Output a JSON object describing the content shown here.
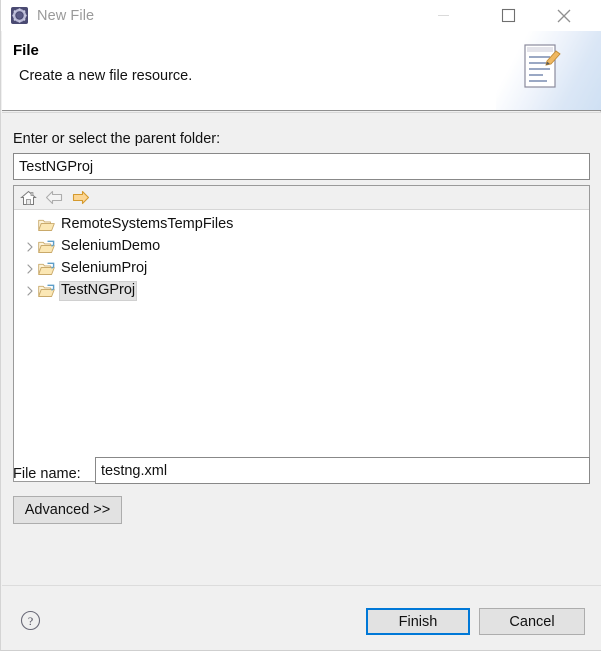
{
  "window": {
    "title": "New File",
    "icon": "eclipse-wizard-icon",
    "controls": [
      {
        "name": "minimize-button",
        "icon": "minimize-icon",
        "label": "Minimize"
      },
      {
        "name": "maximize-button",
        "icon": "maximize-icon",
        "label": "Maximize"
      },
      {
        "name": "close-button",
        "icon": "close-icon",
        "label": "Close"
      }
    ]
  },
  "header": {
    "title": "File",
    "description": "Create a new file resource.",
    "banner_icon": "new-file-document-pencil-icon"
  },
  "form": {
    "parent_folder_label": "Enter or select the parent folder:",
    "parent_folder_value": "TestNGProj",
    "parent_folder_placeholder": "",
    "file_name_label": "File name:",
    "file_name_value": "testng.xml",
    "file_name_placeholder": "",
    "advanced_label": "Advanced >>"
  },
  "tree": {
    "toolbar": [
      {
        "name": "home-button",
        "icon": "home-icon",
        "label": "Home"
      },
      {
        "name": "back-button",
        "icon": "back-arrow-icon",
        "label": "Back"
      },
      {
        "name": "forward-button",
        "icon": "forward-arrow-icon",
        "label": "Forward"
      }
    ],
    "items": [
      {
        "label": "RemoteSystemsTempFiles",
        "expandable": false,
        "selected": false,
        "icon": "folder-icon"
      },
      {
        "label": "SeleniumDemo",
        "expandable": true,
        "selected": false,
        "icon": "project-folder-icon"
      },
      {
        "label": "SeleniumProj",
        "expandable": true,
        "selected": false,
        "icon": "project-folder-icon"
      },
      {
        "label": "TestNGProj",
        "expandable": true,
        "selected": true,
        "icon": "project-folder-icon"
      }
    ]
  },
  "footer": {
    "help_icon": "help-question-icon",
    "finish_label": "Finish",
    "cancel_label": "Cancel"
  },
  "colors": {
    "accent": "#0078d7",
    "dialog_bg": "#f0f0f0",
    "header_bg": "#ffffff",
    "field_bg": "#ffffff",
    "selection_bg": "#e2e2e2",
    "folder_yellow": "#e9c46a",
    "forward_arrow": "#e8a33d"
  }
}
